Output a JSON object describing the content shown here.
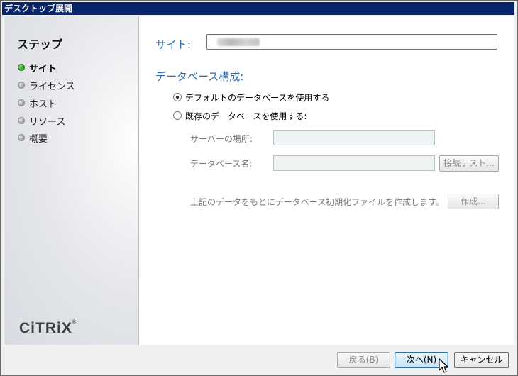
{
  "window": {
    "title": "デスクトップ展開"
  },
  "sidebar": {
    "title": "ステップ",
    "steps": [
      {
        "label": "サイト",
        "state": "active"
      },
      {
        "label": "ライセンス",
        "state": "inactive"
      },
      {
        "label": "ホスト",
        "state": "inactive"
      },
      {
        "label": "リソース",
        "state": "inactive"
      },
      {
        "label": "概要",
        "state": "inactive"
      }
    ],
    "logo": "CiTRiX"
  },
  "main": {
    "site_label": "サイト:",
    "database_header": "データベース構成:",
    "radio_default": "デフォルトのデータベースを使用する",
    "radio_existing": "既存のデータベースを使用する:",
    "server_location_label": "サーバーの場所:",
    "database_name_label": "データベース名:",
    "connection_test_button": "接続テスト...",
    "init_file_text": "上記のデータをもとにデータベース初期化ファイルを作成します。",
    "create_button": "作成..."
  },
  "footer": {
    "back_button": "戻る(B)",
    "next_button": "次へ(N)",
    "cancel_button": "キャンセル"
  },
  "colors": {
    "accent_blue": "#2a6bb0",
    "titlebar": "#0a246a",
    "active_step": "#2f9b20"
  }
}
